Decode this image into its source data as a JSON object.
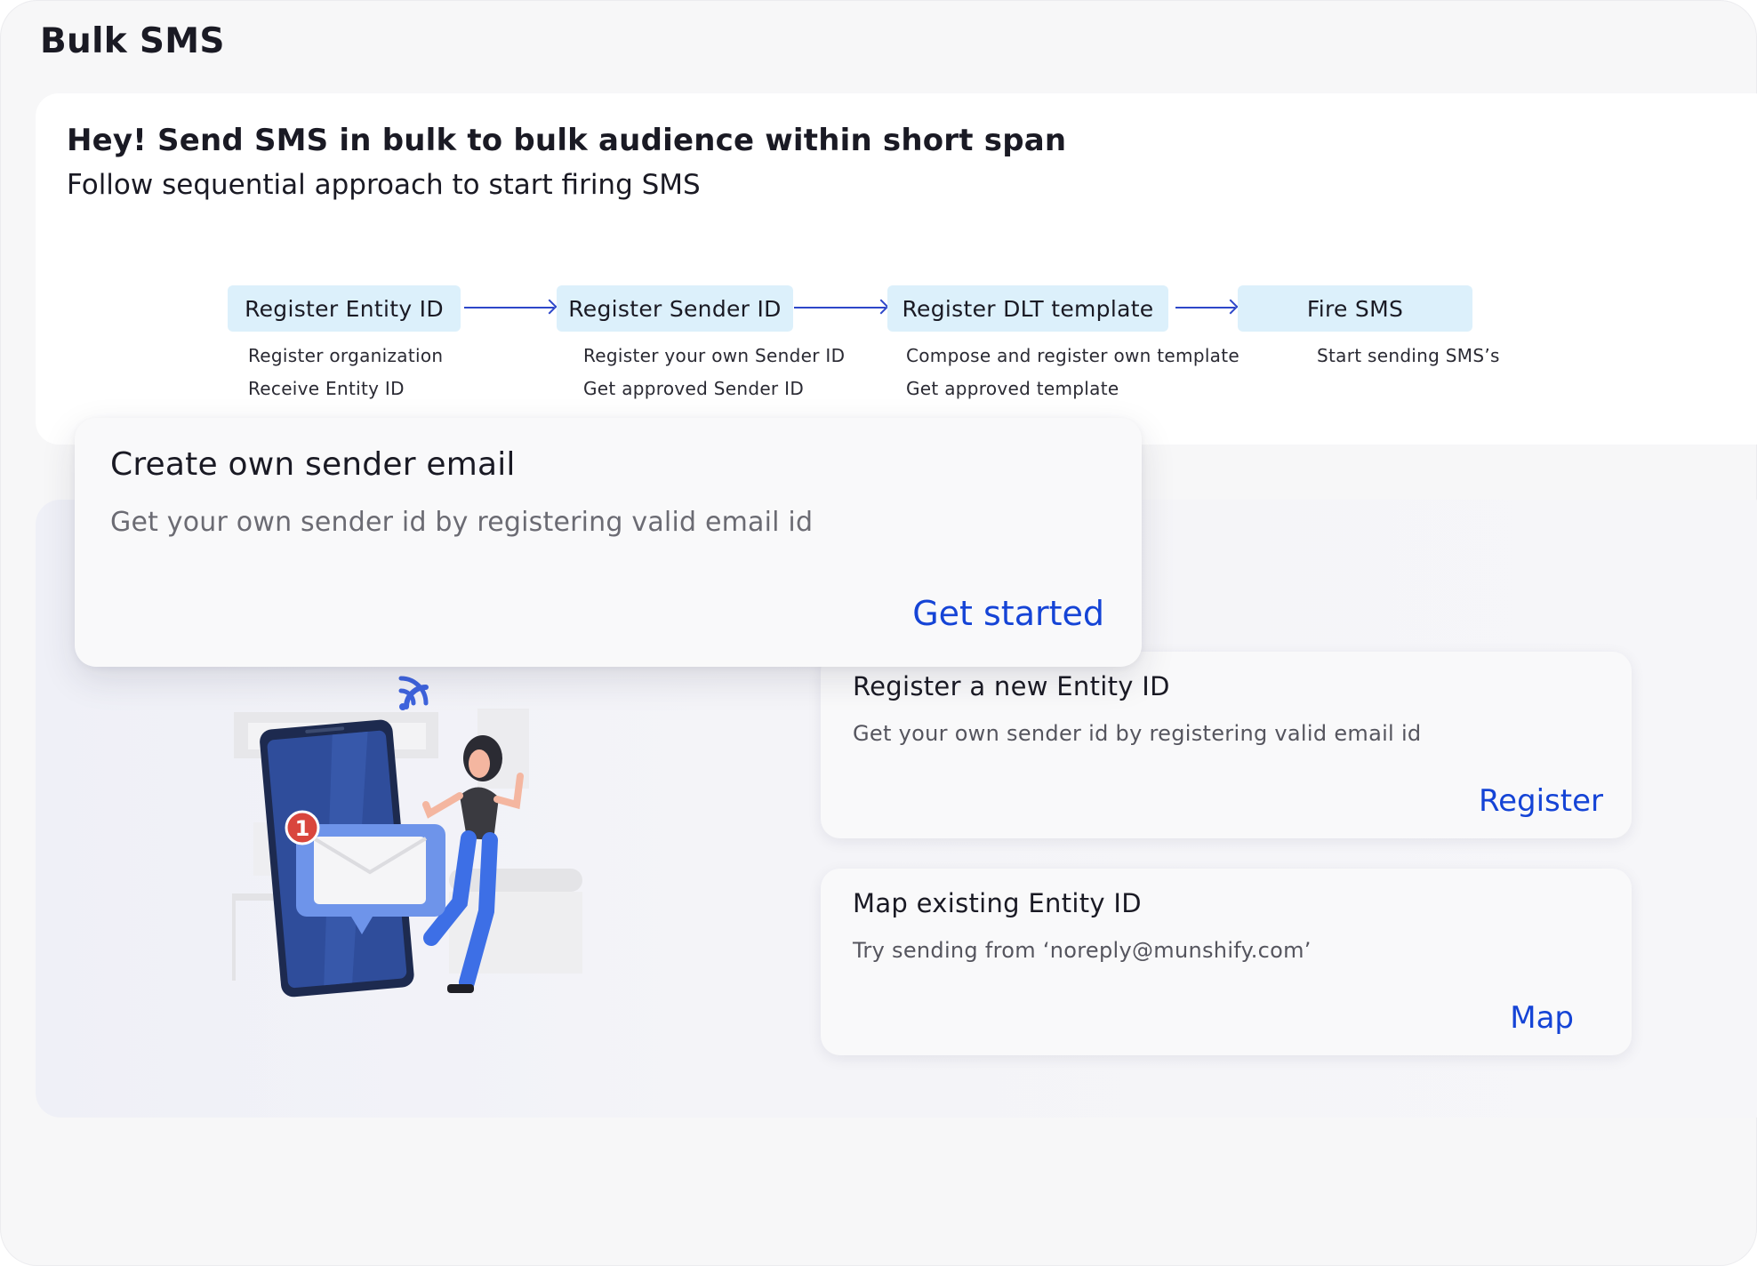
{
  "page": {
    "title": "Bulk SMS"
  },
  "intro": {
    "heading": "Hey! Send SMS in bulk to bulk audience within short span",
    "subheading": "Follow sequential approach to start firing SMS"
  },
  "steps": [
    {
      "label": "Register Entity ID",
      "lines": [
        "Register organization",
        "Receive Entity ID"
      ]
    },
    {
      "label": "Register Sender ID",
      "lines": [
        "Register your own Sender ID",
        "Get approved Sender ID"
      ]
    },
    {
      "label": "Register DLT template",
      "lines": [
        "Compose and register own template",
        "Get approved template"
      ]
    },
    {
      "label": "Fire SMS",
      "lines": [
        "Start sending SMS’s"
      ]
    }
  ],
  "sender_email_card": {
    "title": "Create own sender email",
    "description": "Get your own sender id by registering valid email id",
    "action_label": "Get started"
  },
  "entity_options": [
    {
      "title": "Register a new Entity ID",
      "description": "Get your own sender id by registering valid email id",
      "action_label": "Register"
    },
    {
      "title": "Map existing Entity ID",
      "description": "Try sending from ‘noreply@munshify.com’",
      "action_label": "Map"
    }
  ],
  "illustration": {
    "notification_count": "1",
    "icon": "phone-message-illustration"
  },
  "colors": {
    "accent": "#1544d6",
    "step_chip_bg": "#dcf0fb",
    "arrow": "#2d47c9",
    "badge": "#d9463d"
  }
}
